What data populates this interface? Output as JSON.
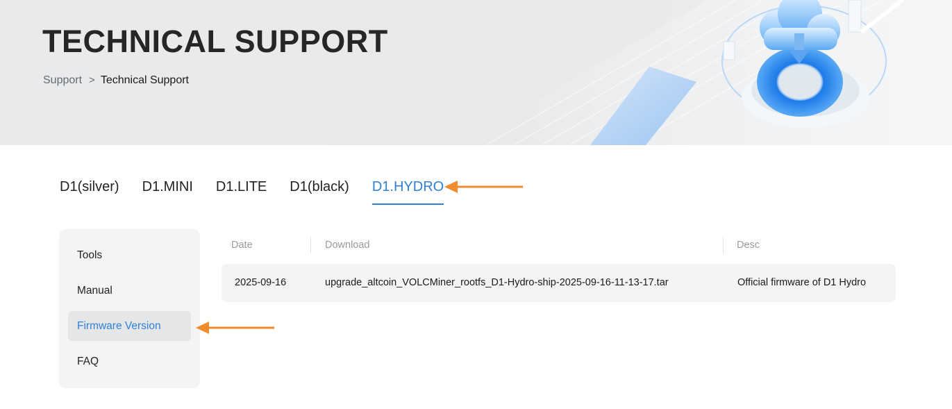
{
  "hero": {
    "title": "TECHNICAL SUPPORT",
    "breadcrumb": {
      "parent": "Support",
      "separator": ">",
      "current": "Technical Support"
    }
  },
  "tabs": [
    {
      "label": "D1(silver)",
      "active": false
    },
    {
      "label": "D1.MINI",
      "active": false
    },
    {
      "label": "D1.LITE",
      "active": false
    },
    {
      "label": "D1(black)",
      "active": false
    },
    {
      "label": "D1.HYDRO",
      "active": true
    }
  ],
  "side_menu": [
    {
      "label": "Tools",
      "active": false
    },
    {
      "label": "Manual",
      "active": false
    },
    {
      "label": "Firmware Version",
      "active": true
    },
    {
      "label": "FAQ",
      "active": false
    }
  ],
  "table": {
    "headers": {
      "date": "Date",
      "download": "Download",
      "desc": "Desc"
    },
    "rows": [
      {
        "date": "2025-09-16",
        "download": "upgrade_altcoin_VOLCMiner_rootfs_D1-Hydro-ship-2025-09-16-11-13-17.tar",
        "desc": "Official firmware of D1 Hydro"
      }
    ]
  },
  "colors": {
    "accent": "#2f80d6",
    "annotation_arrow": "#f28a2e",
    "hero_bg": "#e9eaec",
    "panel_bg": "#f4f4f4"
  },
  "icons": {
    "hero_illustration": "cloud-download-illustration",
    "annotation": "arrow-left-icon"
  }
}
